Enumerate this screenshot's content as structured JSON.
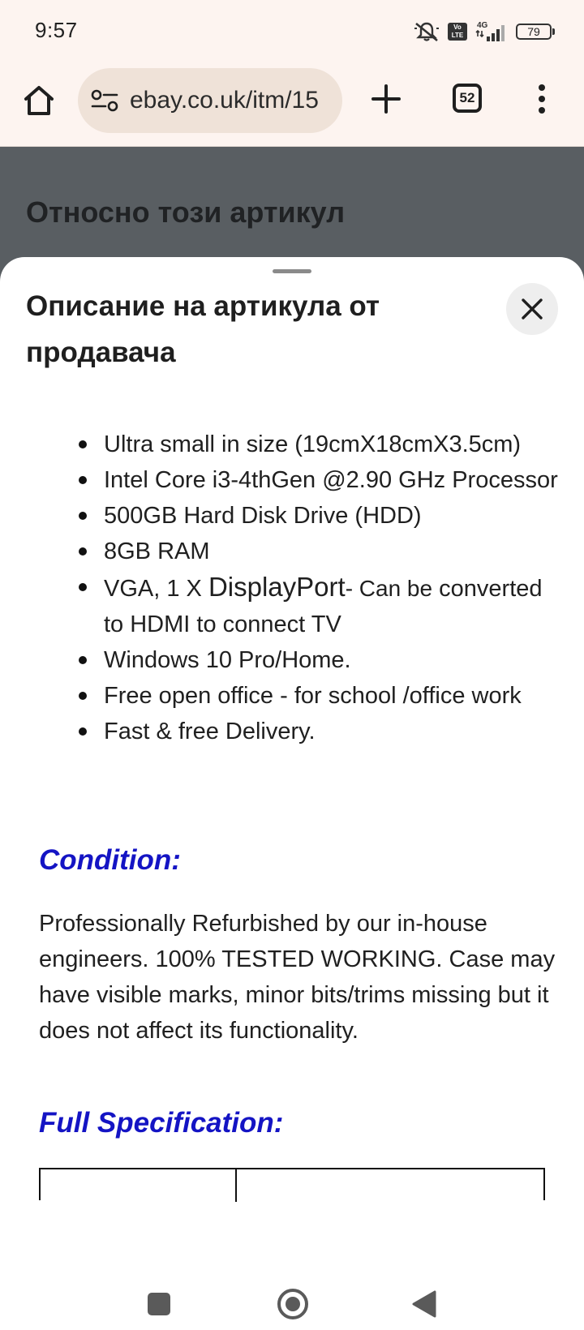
{
  "status_bar": {
    "time": "9:57",
    "volte_label": "Vo LTE",
    "network_label": "4G",
    "battery_level": "79",
    "icons": [
      "mute-icon",
      "volte-icon",
      "signal-icon",
      "battery-icon"
    ]
  },
  "browser": {
    "url": "ebay.co.uk/itm/15",
    "tab_count": "52",
    "icons": [
      "home-icon",
      "site-info-icon",
      "plus-icon",
      "tab-switcher-icon",
      "more-vert-icon"
    ]
  },
  "page_behind": {
    "heading": "Относно този артикул"
  },
  "sheet": {
    "title": "Описание на артикула от продавача",
    "close_icon": "close-icon",
    "features": [
      "Ultra small in size (19cmX18cmX3.5cm)",
      "Intel Core i3-4thGen @2.90 GHz Processor",
      "500GB Hard Disk Drive (HDD)",
      "8GB RAM",
      {
        "prefix": "VGA, 1 X ",
        "emphasis": "DisplayPort",
        "mid": "- Can be",
        "suffix": " converted to HDMI to connect TV"
      },
      "Windows 10 Pro/Home.",
      "Free open office - for school /office work",
      "Fast & free Delivery."
    ],
    "condition_heading": "Condition:",
    "condition_text": "Professionally Refurbished by our in-house engineers. 100% TESTED WORKING. Case may have visible marks, minor bits/trims missing but it does not affect its functionality.",
    "spec_heading": "Full Specification:",
    "heading_color": "#1414c4"
  },
  "nav_bar": {
    "icons": [
      "recents-icon",
      "home-circle-icon",
      "back-icon"
    ]
  }
}
